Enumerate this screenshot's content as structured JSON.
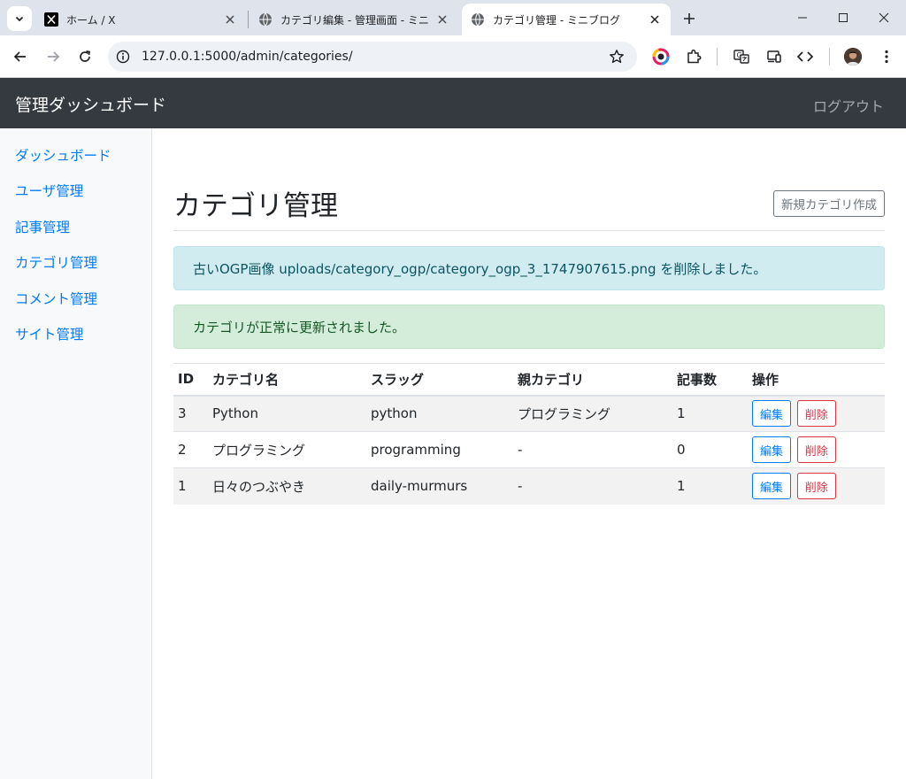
{
  "browser": {
    "tabs": [
      {
        "title": "ホーム / X",
        "active": false
      },
      {
        "title": "カテゴリ編集 - 管理画面 - ミニブログ",
        "active": false
      },
      {
        "title": "カテゴリ管理 - ミニブログ",
        "active": true
      }
    ],
    "url": "127.0.0.1:5000/admin/categories/"
  },
  "navbar": {
    "brand": "管理ダッシュボード",
    "logout": "ログアウト"
  },
  "sidebar": {
    "items": [
      {
        "label": "ダッシュボード"
      },
      {
        "label": "ユーザ管理"
      },
      {
        "label": "記事管理"
      },
      {
        "label": "カテゴリ管理"
      },
      {
        "label": "コメント管理"
      },
      {
        "label": "サイト管理"
      }
    ]
  },
  "main": {
    "title": "カテゴリ管理",
    "new_button": "新規カテゴリ作成",
    "alerts": {
      "info": "古いOGP画像 uploads/category_ogp/category_ogp_3_1747907615.png を削除しました。",
      "success": "カテゴリが正常に更新されました。"
    },
    "table": {
      "headers": [
        "ID",
        "カテゴリ名",
        "スラッグ",
        "親カテゴリ",
        "記事数",
        "操作"
      ],
      "rows": [
        {
          "id": "3",
          "name": "Python",
          "slug": "python",
          "parent": "プログラミング",
          "count": "1"
        },
        {
          "id": "2",
          "name": "プログラミング",
          "slug": "programming",
          "parent": "-",
          "count": "0"
        },
        {
          "id": "1",
          "name": "日々のつぶやき",
          "slug": "daily-murmurs",
          "parent": "-",
          "count": "1"
        }
      ],
      "edit_label": "編集",
      "delete_label": "削除"
    }
  },
  "colors": {
    "navbar_bg": "#343a40",
    "link": "#007bff",
    "danger": "#dc3545",
    "info_bg": "#d1ecf1",
    "success_bg": "#d4edda"
  }
}
